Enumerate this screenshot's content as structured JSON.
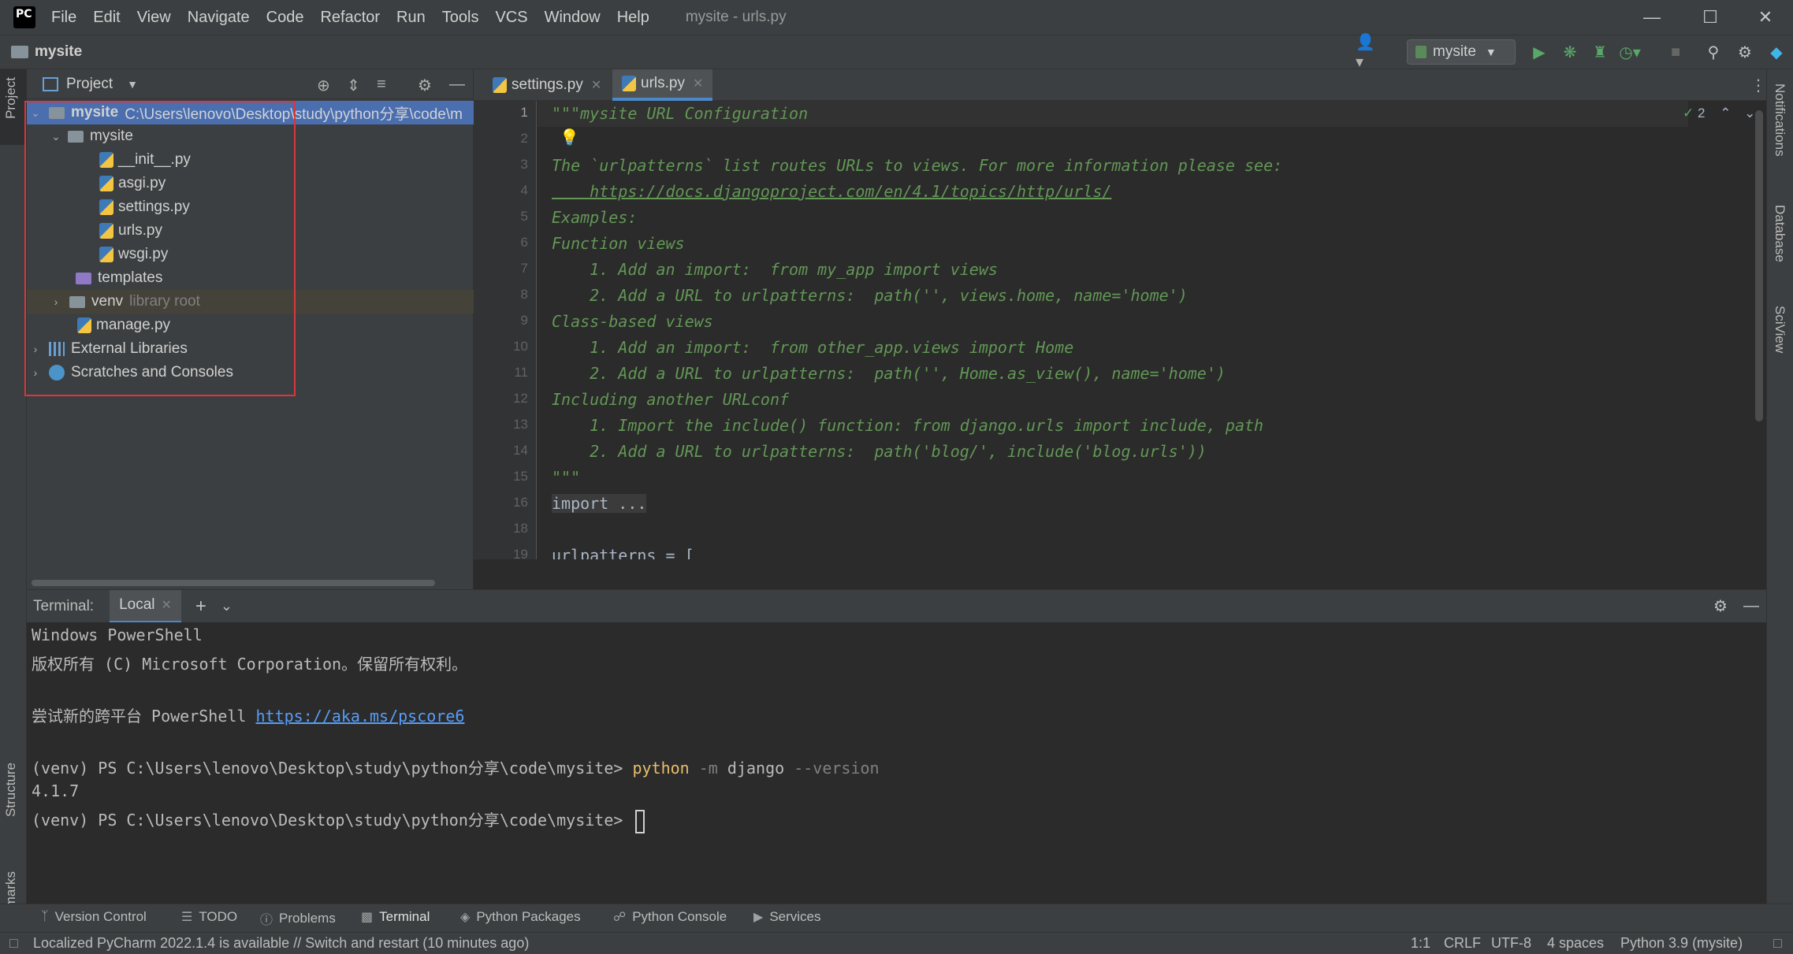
{
  "menubar": {
    "items": [
      "File",
      "Edit",
      "View",
      "Navigate",
      "Code",
      "Refactor",
      "Run",
      "Tools",
      "VCS",
      "Window",
      "Help"
    ],
    "window_title": "mysite - urls.py"
  },
  "navbar": {
    "project_name": "mysite",
    "run_config": "mysite"
  },
  "project_panel": {
    "title": "Project",
    "tree": [
      {
        "label": "mysite",
        "extra": "C:\\Users\\lenovo\\Desktop\\study\\python分享\\code\\m"
      },
      {
        "label": "mysite"
      },
      {
        "label": "__init__.py"
      },
      {
        "label": "asgi.py"
      },
      {
        "label": "settings.py"
      },
      {
        "label": "urls.py"
      },
      {
        "label": "wsgi.py"
      },
      {
        "label": "templates"
      },
      {
        "label": "venv",
        "extra": "library root"
      },
      {
        "label": "manage.py"
      },
      {
        "label": "External Libraries"
      },
      {
        "label": "Scratches and Consoles"
      }
    ]
  },
  "editor": {
    "tabs": [
      {
        "label": "settings.py"
      },
      {
        "label": "urls.py"
      }
    ],
    "inspection_count": "2",
    "line_numbers": [
      "1",
      "2",
      "3",
      "4",
      "5",
      "6",
      "7",
      "8",
      "9",
      "10",
      "11",
      "12",
      "13",
      "14",
      "15",
      "16",
      "18",
      "19"
    ],
    "lines": [
      "\"\"\"mysite URL Configuration",
      "",
      "The `urlpatterns` list routes URLs to views. For more information please see:",
      "    https://docs.djangoproject.com/en/4.1/topics/http/urls/",
      "Examples:",
      "Function views",
      "    1. Add an import:  from my_app import views",
      "    2. Add a URL to urlpatterns:  path('', views.home, name='home')",
      "Class-based views",
      "    1. Add an import:  from other_app.views import Home",
      "    2. Add a URL to urlpatterns:  path('', Home.as_view(), name='home')",
      "Including another URLconf",
      "    1. Import the include() function: from django.urls import include, path",
      "    2. Add a URL to urlpatterns:  path('blog/', include('blog.urls'))",
      "\"\"\"",
      "import ...",
      "",
      "urlpatterns = ["
    ]
  },
  "terminal": {
    "label": "Terminal:",
    "tab": "Local",
    "lines": {
      "l1": "Windows PowerShell",
      "l2": "版权所有 (C) Microsoft Corporation。保留所有权利。",
      "l3_pre": "尝试新的跨平台 PowerShell ",
      "l3_url": "https://aka.ms/pscore6",
      "prompt": "(venv) PS C:\\Users\\lenovo\\Desktop\\study\\python分享\\code\\mysite> ",
      "cmd_python": "python",
      "cmd_flag1": "-m",
      "cmd_django": "django",
      "cmd_flag2": "--version",
      "version": "4.1.7"
    }
  },
  "left_stripe": {
    "project": "Project",
    "structure": "Structure",
    "bookmarks": "Bookmarks"
  },
  "right_stripe": {
    "notifications": "Notifications",
    "database": "Database",
    "sciview": "SciView"
  },
  "tool_windows": [
    "Version Control",
    "TODO",
    "Problems",
    "Terminal",
    "Python Packages",
    "Python Console",
    "Services"
  ],
  "statusbar": {
    "message": "Localized PyCharm 2022.1.4 is available // Switch and restart (10 minutes ago)",
    "position": "1:1",
    "line_sep": "CRLF",
    "encoding": "UTF-8",
    "indent": "4 spaces",
    "interpreter": "Python 3.9 (mysite)"
  },
  "colors": {
    "background": "#2b2b2b",
    "panel": "#3c3f41",
    "selection": "#4b6eaf",
    "docstring": "#629755",
    "highlight_box": "#d9363e"
  }
}
